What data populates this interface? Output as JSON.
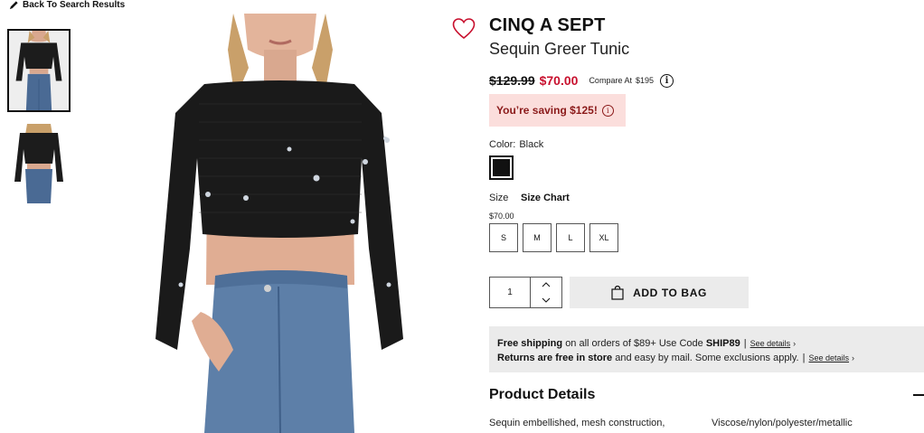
{
  "nav": {
    "back_label": "Back To Search Results",
    "back_icon": "pencil-icon"
  },
  "product": {
    "brand": "CINQ A SEPT",
    "name": "Sequin Greer Tunic",
    "price_original": "$129.99",
    "price_sale": "$70.00",
    "compare_label": "Compare At",
    "compare_value": "$195",
    "saving_text": "You’re saving $125!",
    "color_label": "Color:",
    "color_value": "Black",
    "size_label": "Size",
    "size_chart_label": "Size Chart",
    "size_price": "$70.00",
    "sizes": [
      "S",
      "M",
      "L",
      "XL"
    ],
    "quantity": "1",
    "add_to_bag_label": "ADD TO BAG"
  },
  "shipping": {
    "line1_bold": "Free shipping",
    "line1_text": "on all orders of $89+ Use Code",
    "line1_code": "SHIP89",
    "line2_bold": "Returns are free in store",
    "line2_text": "and easy by mail. Some exclusions apply.",
    "details_label": "See details"
  },
  "details": {
    "title": "Product Details",
    "description_left": "Sequin embellished, mesh construction,",
    "description_right": "Viscose/nylon/polyester/metallic"
  },
  "colors": {
    "sale_red": "#c8102e",
    "saving_bg": "#fbdedc",
    "panel_gray": "#ebebeb",
    "heart_red": "#c8102e"
  }
}
